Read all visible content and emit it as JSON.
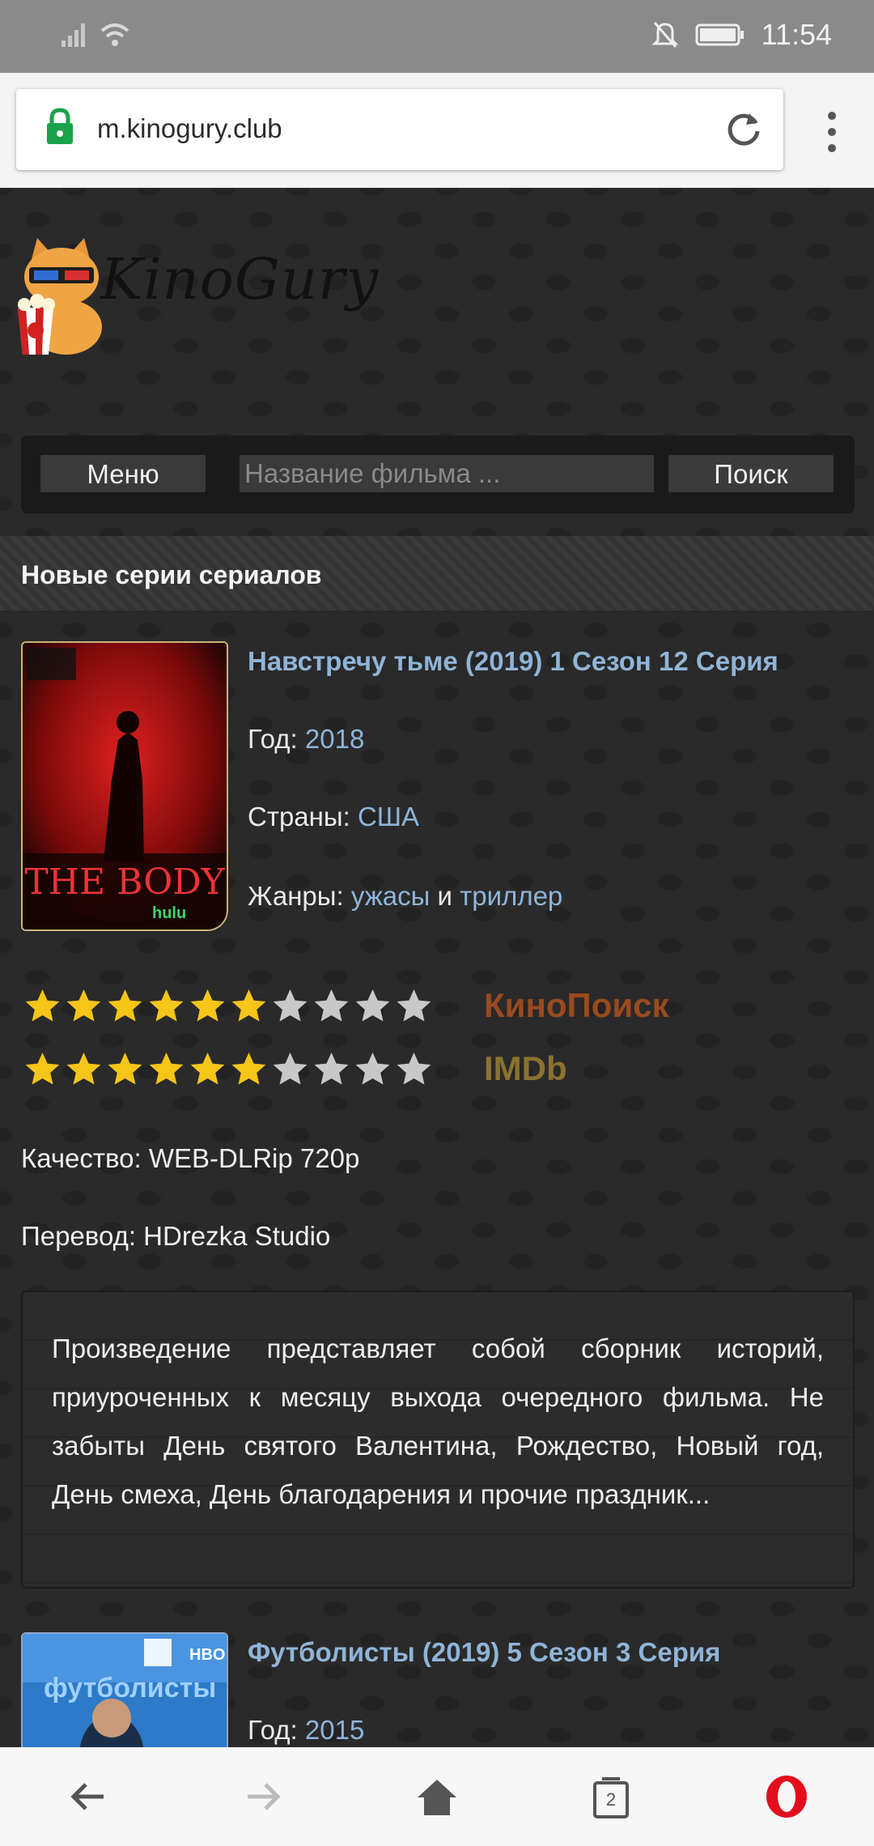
{
  "status_bar": {
    "time": "11:54"
  },
  "browser": {
    "url": "m.kinogury.club"
  },
  "site": {
    "logo_text": "KinoGury",
    "menu_button": "Меню",
    "search_placeholder": "Название фильма ...",
    "search_button": "Поиск"
  },
  "section": {
    "title": "Новые серии сериалов"
  },
  "items": [
    {
      "title": "Навстречу тьме (2019) 1 Сезон 12 Серия",
      "poster_caption": "THE BODY",
      "poster_brand": "hulu",
      "year_label": "Год:",
      "year": "2018",
      "country_label": "Страны:",
      "country": "США",
      "genres_label": "Жанры:",
      "genre_1": "ужасы",
      "genre_joiner": "и",
      "genre_2": "триллер",
      "ratings": [
        {
          "label": "КиноПоиск",
          "stars": 6,
          "out_of": 10,
          "color": "#9a4a1e"
        },
        {
          "label": "IMDb",
          "stars": 6,
          "out_of": 10,
          "color": "#8a7230"
        }
      ],
      "quality": "Качество: WEB-DLRip 720p",
      "translation": "Перевод: HDrezka Studio",
      "description": "Произведение представляет собой сборник историй, приуроченных к месяцу выхода очередного фильма. Не забыты День святого Валентина, Рождество, Новый год, День смеха, День благодарения и прочие праздник..."
    },
    {
      "title": "Футболисты (2019) 5 Сезон 3 Серия",
      "poster_caption": "футболисты",
      "poster_brand": "HBO",
      "year_label": "Год:",
      "year": "2015"
    }
  ],
  "bottom_nav": {
    "tabs_count": "2"
  },
  "colors": {
    "accent_link": "#8fb4d8",
    "star_on": "#f5c518",
    "star_off": "#c8c8c8",
    "opera_red": "#e30d1b"
  }
}
